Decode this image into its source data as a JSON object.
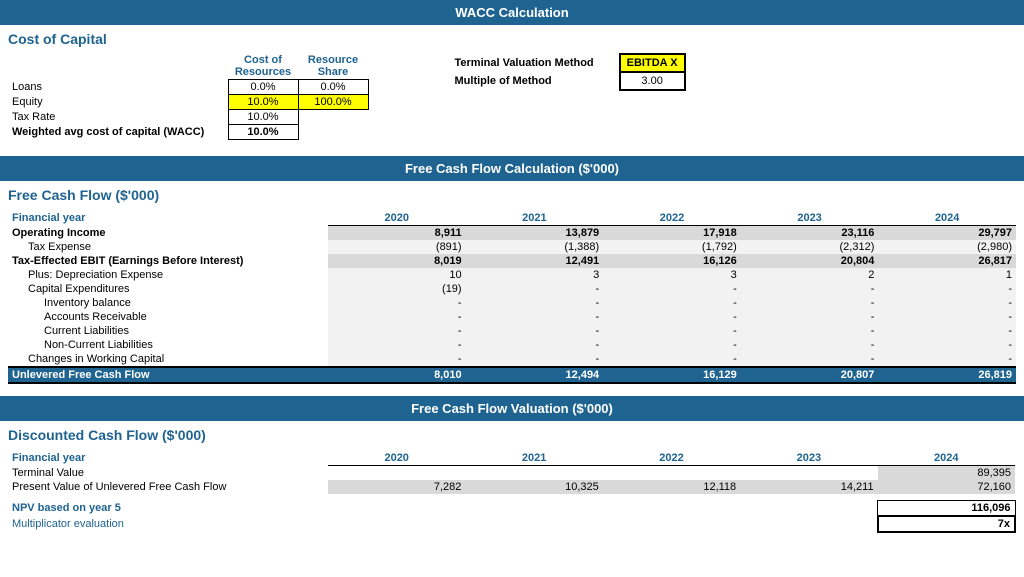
{
  "page": {
    "title": "WACC Calculation"
  },
  "wacc": {
    "section_title": "WACC Calculation",
    "sub_title": "Cost of Capital",
    "col_headers": [
      "Cost of Resources",
      "Resource Share"
    ],
    "rows": [
      {
        "label": "Loans",
        "cost": "0.0%",
        "share": "0.0%"
      },
      {
        "label": "Equity",
        "cost": "10.0%",
        "share": "100.0%"
      },
      {
        "label": "Tax Rate",
        "cost": "10.0%",
        "share": ""
      },
      {
        "label": "Weighted avg cost of capital (WACC)",
        "cost": "10.0%",
        "share": ""
      }
    ],
    "terminal_method_label": "Terminal Valuation Method",
    "multiple_method_label": "Multiple of Method",
    "terminal_method_value": "EBITDA X",
    "multiple_method_value": "3.00"
  },
  "fcf": {
    "section_title": "Free Cash Flow Calculation ($'000)",
    "sub_title": "Free Cash Flow ($'000)",
    "years": [
      "2020",
      "2021",
      "2022",
      "2023",
      "2024"
    ],
    "rows": [
      {
        "label": "Financial year",
        "type": "header",
        "values": [
          "2020",
          "2021",
          "2022",
          "2023",
          "2024"
        ]
      },
      {
        "label": "Operating Income",
        "type": "bold",
        "values": [
          "8,911",
          "13,879",
          "17,918",
          "23,116",
          "29,797"
        ]
      },
      {
        "label": "Tax Expense",
        "type": "indent1",
        "values": [
          "(891)",
          "(1,388)",
          "(1,792)",
          "(2,312)",
          "(2,980)"
        ]
      },
      {
        "label": "Tax-Effected EBIT (Earnings Before Interest)",
        "type": "bold",
        "values": [
          "8,019",
          "12,491",
          "16,126",
          "20,804",
          "26,817"
        ]
      },
      {
        "label": "Plus: Depreciation Expense",
        "type": "indent1",
        "values": [
          "10",
          "3",
          "3",
          "2",
          "1"
        ]
      },
      {
        "label": "Capital Expenditures",
        "type": "indent1",
        "values": [
          "(19)",
          "-",
          "-",
          "-",
          "-"
        ]
      },
      {
        "label": "Inventory balance",
        "type": "indent2",
        "values": [
          "-",
          "-",
          "-",
          "-",
          "-"
        ]
      },
      {
        "label": "Accounts Receivable",
        "type": "indent2",
        "values": [
          "-",
          "-",
          "-",
          "-",
          "-"
        ]
      },
      {
        "label": "Current Liabilities",
        "type": "indent2",
        "values": [
          "-",
          "-",
          "-",
          "-",
          "-"
        ]
      },
      {
        "label": "Non-Current Liabilities",
        "type": "indent2",
        "values": [
          "-",
          "-",
          "-",
          "-",
          "-"
        ]
      },
      {
        "label": "Changes in Working Capital",
        "type": "indent1",
        "values": [
          "-",
          "-",
          "-",
          "-",
          "-"
        ]
      },
      {
        "label": "Unlevered Free Cash Flow",
        "type": "total",
        "values": [
          "8,010",
          "12,494",
          "16,129",
          "20,807",
          "26,819"
        ]
      }
    ]
  },
  "dcf": {
    "section_title": "Free Cash Flow Valuation ($'000)",
    "sub_title": "Discounted Cash Flow ($'000)",
    "years": [
      "2020",
      "2021",
      "2022",
      "2023",
      "2024"
    ],
    "rows": [
      {
        "label": "Financial year",
        "type": "header",
        "values": [
          "2020",
          "2021",
          "2022",
          "2023",
          "2024"
        ]
      },
      {
        "label": "Terminal Value",
        "type": "normal",
        "values": [
          "",
          "",
          "",
          "",
          "89,395"
        ]
      },
      {
        "label": "Present Value of Unlevered Free Cash Flow",
        "type": "normal",
        "values": [
          "7,282",
          "10,325",
          "12,118",
          "14,211",
          "72,160"
        ]
      }
    ],
    "npv_label": "NPV based on year 5",
    "npv_value": "116,096",
    "mult_label": "Multiplicator evaluation",
    "mult_value": "7x"
  }
}
